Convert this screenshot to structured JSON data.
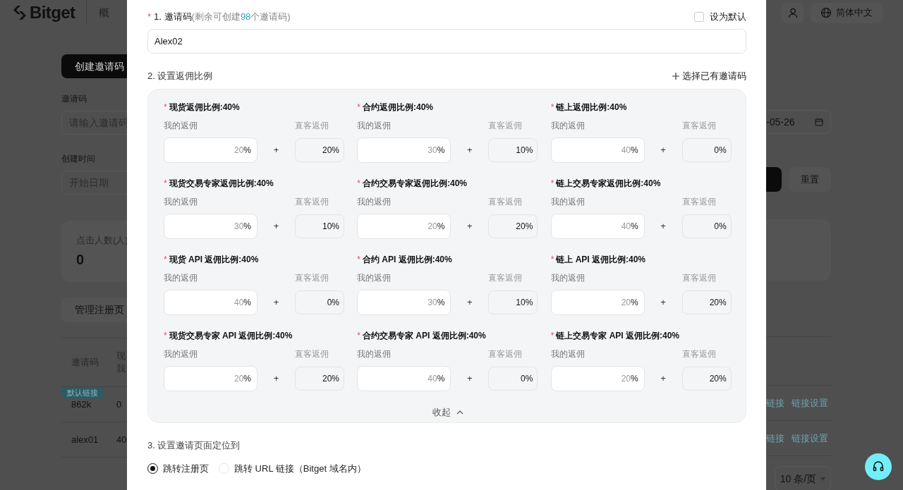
{
  "header": {
    "logo": "Bitget",
    "nav_item": "概",
    "language": "简体中文"
  },
  "background": {
    "create_button": "创建邀请码",
    "code_filter": {
      "label": "邀请码",
      "placeholder": "请输入邀请码"
    },
    "time_filter": {
      "label": "创建时间",
      "placeholder": "开始日期",
      "end_value": "-05-26"
    },
    "reset_button": "重置",
    "stat": {
      "label": "点击人数(人)",
      "value": "0"
    },
    "manage_button": "管理注册页",
    "table": {
      "columns": [
        {
          "lines": [
            "邀请码"
          ]
        },
        {
          "lines": [
            "现",
            "我"
          ]
        }
      ],
      "rows": [
        {
          "badge": "默认链接",
          "cells": [
            "862k",
            "0"
          ],
          "actions": [
            "链接",
            "链接设置"
          ]
        },
        {
          "cells": [
            "alex01",
            "40"
          ],
          "actions": [
            "链接",
            "链接设置"
          ]
        }
      ]
    },
    "page_size": "10 条/页"
  },
  "modal": {
    "code_section": {
      "required_mark": "*",
      "title": "1. 邀请码",
      "note_before": "(剩余可创建",
      "remaining": "98",
      "note_after": "个邀请码)",
      "value": "Alex02",
      "default_checkbox": {
        "label": "设为默认",
        "checked": false
      }
    },
    "rate_section": {
      "title": "2. 设置返佣比例",
      "pick_link": "选择已有邀请码",
      "collapse": "收起",
      "expanded": true,
      "groups": [
        {
          "required_mark": "*",
          "title": "现货返佣比例:40%",
          "mine_label": "我的返佣",
          "mine_placeholder": "20",
          "unit": "%",
          "operator": "+",
          "direct_label": "直客返佣",
          "direct_value": "20%"
        },
        {
          "required_mark": "*",
          "title": "合约返佣比例:40%",
          "mine_label": "我的返佣",
          "mine_placeholder": "30",
          "unit": "%",
          "operator": "+",
          "direct_label": "直客返佣",
          "direct_value": "10%"
        },
        {
          "required_mark": "*",
          "title": "链上返佣比例:40%",
          "mine_label": "我的返佣",
          "mine_placeholder": "40",
          "unit": "%",
          "operator": "+",
          "direct_label": "直客返佣",
          "direct_value": "0%"
        },
        {
          "required_mark": "*",
          "title": "现货交易专家返佣比例:40%",
          "mine_label": "我的返佣",
          "mine_placeholder": "30",
          "unit": "%",
          "operator": "+",
          "direct_label": "直客返佣",
          "direct_value": "10%"
        },
        {
          "required_mark": "*",
          "title": "合约交易专家返佣比例:40%",
          "mine_label": "我的返佣",
          "mine_placeholder": "20",
          "unit": "%",
          "operator": "+",
          "direct_label": "直客返佣",
          "direct_value": "20%"
        },
        {
          "required_mark": "*",
          "title": "链上交易专家返佣比例:40%",
          "mine_label": "我的返佣",
          "mine_placeholder": "40",
          "unit": "%",
          "operator": "+",
          "direct_label": "直客返佣",
          "direct_value": "0%"
        },
        {
          "required_mark": "*",
          "title": "现货 API 返佣比例:40%",
          "mine_label": "我的返佣",
          "mine_placeholder": "40",
          "unit": "%",
          "operator": "+",
          "direct_label": "直客返佣",
          "direct_value": "0%"
        },
        {
          "required_mark": "*",
          "title": "合约 API 返佣比例:40%",
          "mine_label": "我的返佣",
          "mine_placeholder": "30",
          "unit": "%",
          "operator": "+",
          "direct_label": "直客返佣",
          "direct_value": "10%"
        },
        {
          "required_mark": "*",
          "title": "链上 API 返佣比例:40%",
          "mine_label": "我的返佣",
          "mine_placeholder": "20",
          "unit": "%",
          "operator": "+",
          "direct_label": "直客返佣",
          "direct_value": "20%"
        },
        {
          "required_mark": "*",
          "title": "现货交易专家 API 返佣比例:40%",
          "mine_label": "我的返佣",
          "mine_placeholder": "20",
          "unit": "%",
          "operator": "+",
          "direct_label": "直客返佣",
          "direct_value": "20%"
        },
        {
          "required_mark": "*",
          "title": "合约交易专家 API 返佣比例:40%",
          "mine_label": "我的返佣",
          "mine_placeholder": "40",
          "unit": "%",
          "operator": "+",
          "direct_label": "直客返佣",
          "direct_value": "0%"
        },
        {
          "required_mark": "*",
          "title": "链上交易专家 API 返佣比例:40%",
          "mine_label": "我的返佣",
          "mine_placeholder": "20",
          "unit": "%",
          "operator": "+",
          "direct_label": "直客返佣",
          "direct_value": "20%"
        }
      ]
    },
    "target_section": {
      "title": "3. 设置邀请页面定位到",
      "options": [
        {
          "label": "跳转注册页",
          "selected": true
        },
        {
          "label": "跳转 URL 链接（Bitget 域名内）",
          "selected": false
        }
      ]
    }
  }
}
